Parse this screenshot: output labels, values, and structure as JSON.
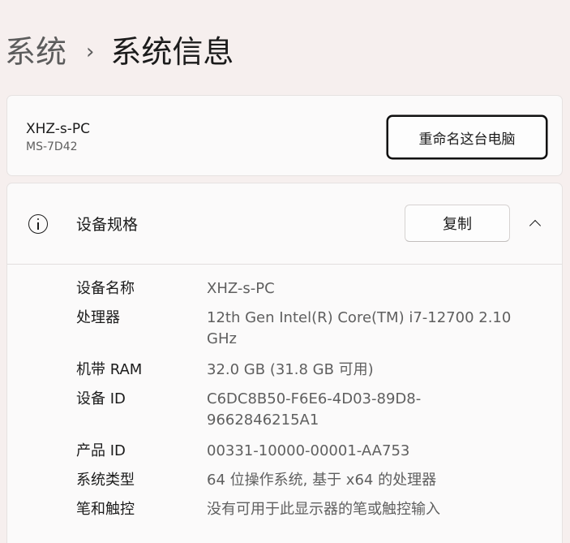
{
  "breadcrumb": {
    "parent": "系统",
    "separator": "›",
    "current": "系统信息"
  },
  "pc": {
    "name": "XHZ-s-PC",
    "model": "MS-7D42",
    "rename_label": "重命名这台电脑"
  },
  "spec": {
    "title": "设备规格",
    "icon": "info-icon",
    "copy_label": "复制",
    "rows": [
      {
        "label": "设备名称",
        "value": "XHZ-s-PC"
      },
      {
        "label": "处理器",
        "value": "12th Gen Intel(R) Core(TM) i7-12700   2.10 GHz"
      },
      {
        "label": "机带 RAM",
        "value": "32.0 GB (31.8 GB 可用)"
      },
      {
        "label": "设备 ID",
        "value": "C6DC8B50-F6E6-4D03-89D8-9662846215A1"
      },
      {
        "label": "产品 ID",
        "value": "00331-10000-00001-AA753"
      },
      {
        "label": "系统类型",
        "value": "64 位操作系统, 基于 x64 的处理器"
      },
      {
        "label": "笔和触控",
        "value": "没有可用于此显示器的笔或触控输入"
      }
    ]
  }
}
